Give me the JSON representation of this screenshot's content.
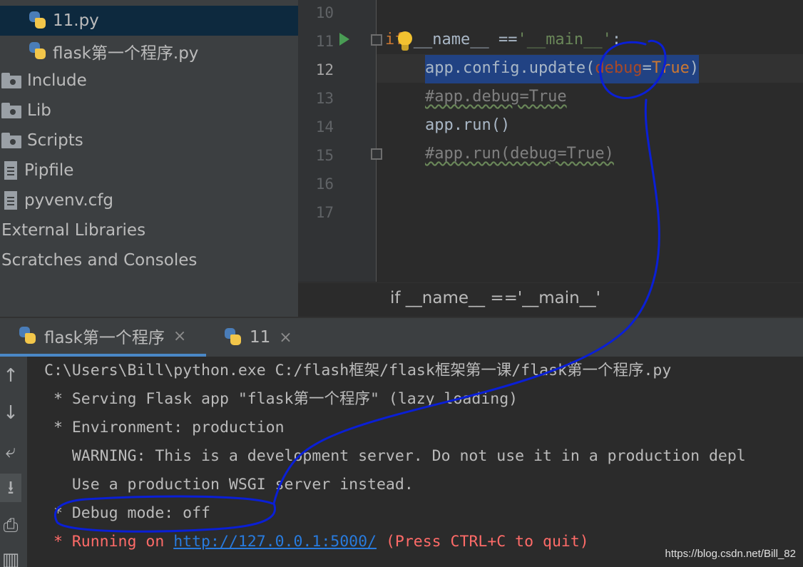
{
  "project_tree": {
    "items": [
      {
        "label": "11.py",
        "icon": "python-file-icon",
        "selected": true
      },
      {
        "label": "flask第一个程序.py",
        "icon": "python-file-icon"
      },
      {
        "label": "Include",
        "icon": "folder-icon"
      },
      {
        "label": "Lib",
        "icon": "folder-icon"
      },
      {
        "label": "Scripts",
        "icon": "folder-icon"
      },
      {
        "label": "Pipfile",
        "icon": "text-file-icon"
      },
      {
        "label": "pyvenv.cfg",
        "icon": "text-file-icon"
      },
      {
        "label": "External Libraries",
        "icon": ""
      },
      {
        "label": "Scratches and Consoles",
        "icon": ""
      }
    ]
  },
  "editor": {
    "line_numbers": [
      "10",
      "11",
      "12",
      "13",
      "14",
      "15",
      "16",
      "17"
    ],
    "current_line": "12",
    "lines": {
      "l11": {
        "kw": "if",
        "rest": " __name__ ==",
        "str": "'__main__'",
        "end": ":"
      },
      "l12": {
        "pre": "app.config.update(",
        "param": "debug",
        "eq": "=",
        "val": "True",
        "post": ")"
      },
      "l13": "#app.debug=True",
      "l14": "app.run()",
      "l15": "#app.run(debug=True)"
    },
    "breadcrumb": "if __name__ =='__main__'"
  },
  "run_panel": {
    "tabs": [
      {
        "label": "flask第一个程序",
        "close": "×",
        "active": true
      },
      {
        "label": "11",
        "close": "×",
        "active": false
      }
    ],
    "toolbar_icons": [
      "arrow-up-icon",
      "arrow-down-icon",
      "soft-wrap-icon",
      "scroll-to-end-icon",
      "print-icon",
      "trash-icon"
    ],
    "console": {
      "l1": "C:\\Users\\Bill\\python.exe C:/flash框架/flask框架第一课/flask第一个程序.py",
      "l2": " * Serving Flask app \"flask第一个程序\" (lazy loading)",
      "l3": " * Environment: production",
      "l4": "   WARNING: This is a development server. Do not use it in a production depl",
      "l5": "   Use a production WSGI server instead.",
      "l6": " * Debug mode: off",
      "l7_prefix": " * Running on ",
      "l7_link": "http://127.0.0.1:5000/",
      "l7_suffix": " (Press CTRL+C to quit)"
    }
  },
  "watermark": "https://blog.csdn.net/Bill_82",
  "colors": {
    "annotation": "#0a1fd6",
    "selection": "#214283",
    "error_red": "#ff6b68",
    "link_blue": "#287bde"
  }
}
